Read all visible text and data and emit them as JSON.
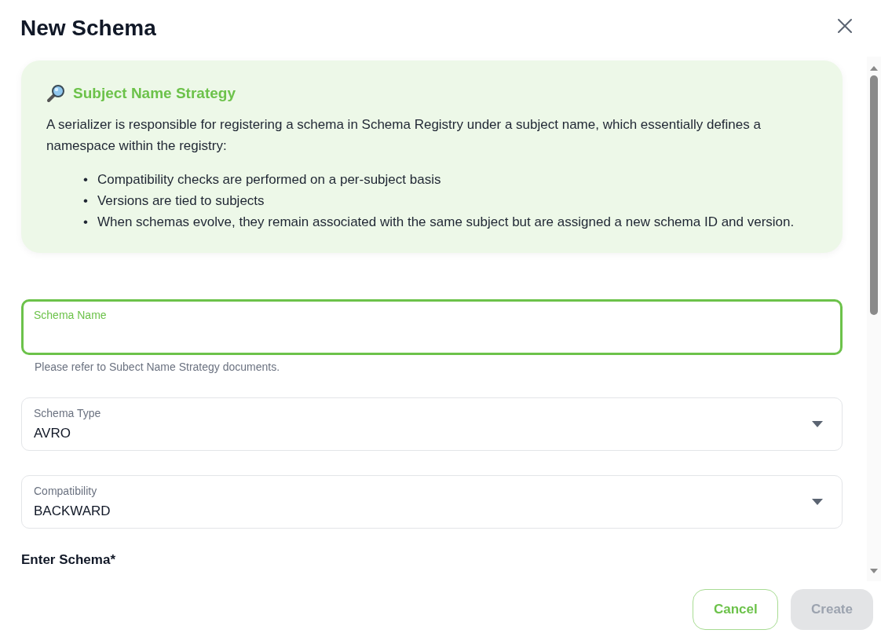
{
  "dialog": {
    "title": "New Schema"
  },
  "info": {
    "title": "Subject Name Strategy",
    "text": "A serializer is responsible for registering a schema in Schema Registry under a subject name, which essentially defines a namespace within the registry:",
    "marker": "•",
    "bullets": [
      "Compatibility checks are performed on a per-subject basis",
      "Versions are tied to subjects",
      "When schemas evolve, they remain associated with the same subject but are assigned a new schema ID and version."
    ]
  },
  "fields": [
    {
      "kind": "text",
      "label": "Schema Name",
      "focused": true,
      "helper": "Please refer to Subect Name Strategy documents."
    },
    {
      "kind": "select",
      "label": "Schema Type",
      "value": "AVRO",
      "focused": false
    },
    {
      "kind": "select",
      "label": "Compatibility",
      "value": "BACKWARD",
      "focused": false
    }
  ],
  "section_label": "Enter Schema*",
  "buttons": [
    {
      "label": "Cancel",
      "disabled": false
    },
    {
      "label": "Create",
      "disabled": true
    }
  ]
}
